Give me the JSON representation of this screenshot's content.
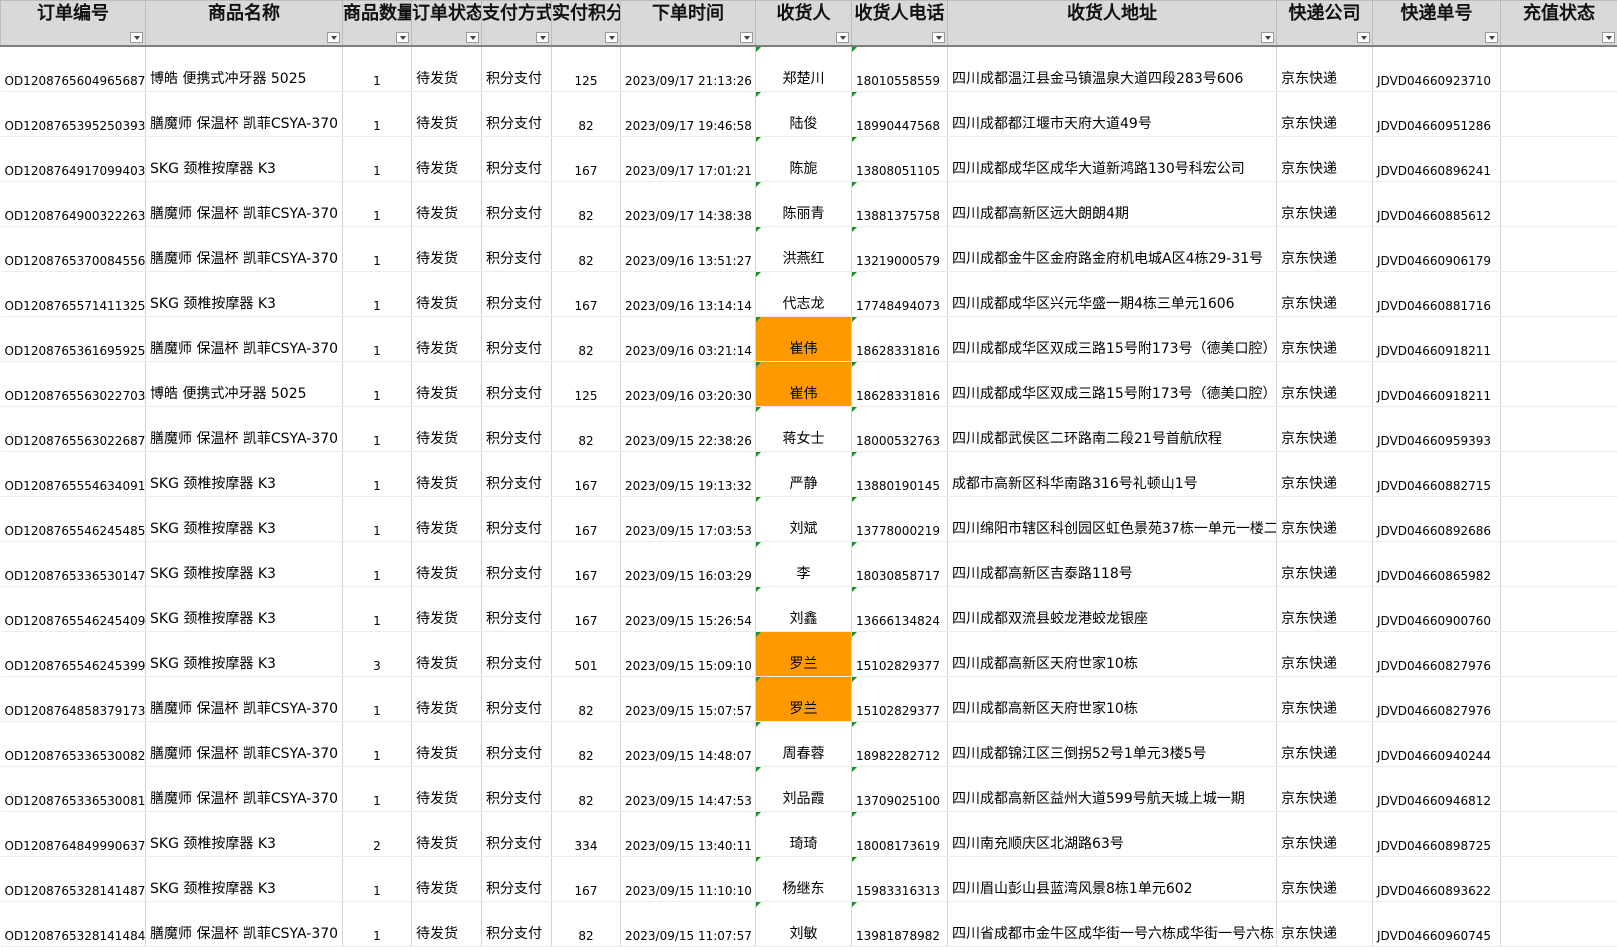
{
  "headers": [
    "订单编号",
    "商品名称",
    "商品数量",
    "订单状态",
    "支付方式",
    "实付积分",
    "下单时间",
    "收货人",
    "收货人电话",
    "收货人地址",
    "快递公司",
    "快递单号",
    "充值状态"
  ],
  "highlight_color": "#ff9900",
  "rows": [
    {
      "order": "OD1208765604965687",
      "product": "博皓 便携式冲牙器 5025",
      "qty": "1",
      "status": "待发货",
      "pay": "积分支付",
      "points": "125",
      "time": "2023/09/17 21:13:26",
      "name": "郑楚川",
      "phone": "18010558559",
      "address": "四川成都温江县金马镇温泉大道四段283号606",
      "courier": "京东快递",
      "tracking": "JDVD04660923710",
      "highlight": false
    },
    {
      "order": "OD1208765395250393",
      "product": "膳魔师 保温杯 凯菲CSYA-370",
      "qty": "1",
      "status": "待发货",
      "pay": "积分支付",
      "points": "82",
      "time": "2023/09/17 19:46:58",
      "name": "陆俊",
      "phone": "18990447568",
      "address": "四川成都都江堰市天府大道49号",
      "courier": "京东快递",
      "tracking": "JDVD04660951286",
      "highlight": false
    },
    {
      "order": "OD1208764917099403",
      "product": "SKG 颈椎按摩器 K3",
      "qty": "1",
      "status": "待发货",
      "pay": "积分支付",
      "points": "167",
      "time": "2023/09/17 17:01:21",
      "name": "陈旎",
      "phone": "13808051105",
      "address": "四川成都成华区成华大道新鸿路130号科宏公司",
      "courier": "京东快递",
      "tracking": "JDVD04660896241",
      "highlight": false
    },
    {
      "order": "OD1208764900322263",
      "product": "膳魔师 保温杯 凯菲CSYA-370",
      "qty": "1",
      "status": "待发货",
      "pay": "积分支付",
      "points": "82",
      "time": "2023/09/17 14:38:38",
      "name": "陈丽青",
      "phone": "13881375758",
      "address": "四川成都高新区远大朗朗4期",
      "courier": "京东快递",
      "tracking": "JDVD04660885612",
      "highlight": false
    },
    {
      "order": "OD1208765370084556",
      "product": "膳魔师 保温杯 凯菲CSYA-370",
      "qty": "1",
      "status": "待发货",
      "pay": "积分支付",
      "points": "82",
      "time": "2023/09/16 13:51:27",
      "name": "洪燕红",
      "phone": "13219000579",
      "address": "四川成都金牛区金府路金府机电城A区4栋29-31号",
      "courier": "京东快递",
      "tracking": "JDVD04660906179",
      "highlight": false
    },
    {
      "order": "OD1208765571411325",
      "product": "SKG 颈椎按摩器 K3",
      "qty": "1",
      "status": "待发货",
      "pay": "积分支付",
      "points": "167",
      "time": "2023/09/16 13:14:14",
      "name": "代志龙",
      "phone": "17748494073",
      "address": "四川成都成华区兴元华盛一期4栋三单元1606",
      "courier": "京东快递",
      "tracking": "JDVD04660881716",
      "highlight": false
    },
    {
      "order": "OD1208765361695925",
      "product": "膳魔师 保温杯 凯菲CSYA-370",
      "qty": "1",
      "status": "待发货",
      "pay": "积分支付",
      "points": "82",
      "time": "2023/09/16 03:21:14",
      "name": "崔伟",
      "phone": "18628331816",
      "address": "四川成都成华区双成三路15号附173号（德美口腔）",
      "courier": "京东快递",
      "tracking": "JDVD04660918211",
      "highlight": true
    },
    {
      "order": "OD1208765563022703",
      "product": "博皓 便携式冲牙器 5025",
      "qty": "1",
      "status": "待发货",
      "pay": "积分支付",
      "points": "125",
      "time": "2023/09/16 03:20:30",
      "name": "崔伟",
      "phone": "18628331816",
      "address": "四川成都成华区双成三路15号附173号（德美口腔）",
      "courier": "京东快递",
      "tracking": "JDVD04660918211",
      "highlight": true
    },
    {
      "order": "OD1208765563022687",
      "product": "膳魔师 保温杯 凯菲CSYA-370",
      "qty": "1",
      "status": "待发货",
      "pay": "积分支付",
      "points": "82",
      "time": "2023/09/15 22:38:26",
      "name": "蒋女士",
      "phone": "18000532763",
      "address": "四川成都武侯区二环路南二段21号首航欣程",
      "courier": "京东快递",
      "tracking": "JDVD04660959393",
      "highlight": false
    },
    {
      "order": "OD1208765554634091",
      "product": "SKG 颈椎按摩器 K3",
      "qty": "1",
      "status": "待发货",
      "pay": "积分支付",
      "points": "167",
      "time": "2023/09/15 19:13:32",
      "name": "严静",
      "phone": "13880190145",
      "address": "成都市高新区科华南路316号礼顿山1号",
      "courier": "京东快递",
      "tracking": "JDVD04660882715",
      "highlight": false
    },
    {
      "order": "OD1208765546245485",
      "product": "SKG 颈椎按摩器 K3",
      "qty": "1",
      "status": "待发货",
      "pay": "积分支付",
      "points": "167",
      "time": "2023/09/15 17:03:53",
      "name": "刘斌",
      "phone": "13778000219",
      "address": "四川绵阳市辖区科创园区虹色景苑37栋一单元一楼二",
      "courier": "京东快递",
      "tracking": "JDVD04660892686",
      "highlight": false
    },
    {
      "order": "OD1208765336530147",
      "product": "SKG 颈椎按摩器 K3",
      "qty": "1",
      "status": "待发货",
      "pay": "积分支付",
      "points": "167",
      "time": "2023/09/15 16:03:29",
      "name": "李",
      "phone": "18030858717",
      "address": "四川成都高新区吉泰路118号",
      "courier": "京东快递",
      "tracking": "JDVD04660865982",
      "highlight": false
    },
    {
      "order": "OD1208765546245409",
      "product": "SKG 颈椎按摩器 K3",
      "qty": "1",
      "status": "待发货",
      "pay": "积分支付",
      "points": "167",
      "time": "2023/09/15 15:26:54",
      "name": "刘鑫",
      "phone": "13666134824",
      "address": "四川成都双流县蛟龙港蛟龙银座",
      "courier": "京东快递",
      "tracking": "JDVD04660900760",
      "highlight": false
    },
    {
      "order": "OD1208765546245399",
      "product": "SKG 颈椎按摩器 K3",
      "qty": "3",
      "status": "待发货",
      "pay": "积分支付",
      "points": "501",
      "time": "2023/09/15 15:09:10",
      "name": "罗兰",
      "phone": "15102829377",
      "address": "四川成都高新区天府世家10栋",
      "courier": "京东快递",
      "tracking": "JDVD04660827976",
      "highlight": true
    },
    {
      "order": "OD1208764858379173",
      "product": "膳魔师 保温杯 凯菲CSYA-370",
      "qty": "1",
      "status": "待发货",
      "pay": "积分支付",
      "points": "82",
      "time": "2023/09/15 15:07:57",
      "name": "罗兰",
      "phone": "15102829377",
      "address": "四川成都高新区天府世家10栋",
      "courier": "京东快递",
      "tracking": "JDVD04660827976",
      "highlight": true
    },
    {
      "order": "OD1208765336530082",
      "product": "膳魔师 保温杯 凯菲CSYA-370",
      "qty": "1",
      "status": "待发货",
      "pay": "积分支付",
      "points": "82",
      "time": "2023/09/15 14:48:07",
      "name": "周春蓉",
      "phone": "18982282712",
      "address": "四川成都锦江区三倒拐52号1单元3楼5号",
      "courier": "京东快递",
      "tracking": "JDVD04660940244",
      "highlight": false
    },
    {
      "order": "OD1208765336530081",
      "product": "膳魔师 保温杯 凯菲CSYA-370",
      "qty": "1",
      "status": "待发货",
      "pay": "积分支付",
      "points": "82",
      "time": "2023/09/15 14:47:53",
      "name": "刘品霞",
      "phone": "13709025100",
      "address": "四川成都高新区益州大道599号航天城上城一期",
      "courier": "京东快递",
      "tracking": "JDVD04660946812",
      "highlight": false
    },
    {
      "order": "OD1208764849990637",
      "product": "SKG 颈椎按摩器 K3",
      "qty": "2",
      "status": "待发货",
      "pay": "积分支付",
      "points": "334",
      "time": "2023/09/15 13:40:11",
      "name": "琦琦",
      "phone": "18008173619",
      "address": "四川南充顺庆区北湖路63号",
      "courier": "京东快递",
      "tracking": "JDVD04660898725",
      "highlight": false
    },
    {
      "order": "OD1208765328141487",
      "product": "SKG 颈椎按摩器 K3",
      "qty": "1",
      "status": "待发货",
      "pay": "积分支付",
      "points": "167",
      "time": "2023/09/15 11:10:10",
      "name": "杨继东",
      "phone": "15983316313",
      "address": "四川眉山彭山县蓝湾风景8栋1单元602",
      "courier": "京东快递",
      "tracking": "JDVD04660893622",
      "highlight": false
    },
    {
      "order": "OD1208765328141484",
      "product": "膳魔师 保温杯 凯菲CSYA-370",
      "qty": "1",
      "status": "待发货",
      "pay": "积分支付",
      "points": "82",
      "time": "2023/09/15 11:07:57",
      "name": "刘敏",
      "phone": "13981878982",
      "address": "四川省成都市金牛区成华街一号六栋成华街一号六栋",
      "courier": "京东快递",
      "tracking": "JDVD04660960745",
      "highlight": false
    }
  ]
}
